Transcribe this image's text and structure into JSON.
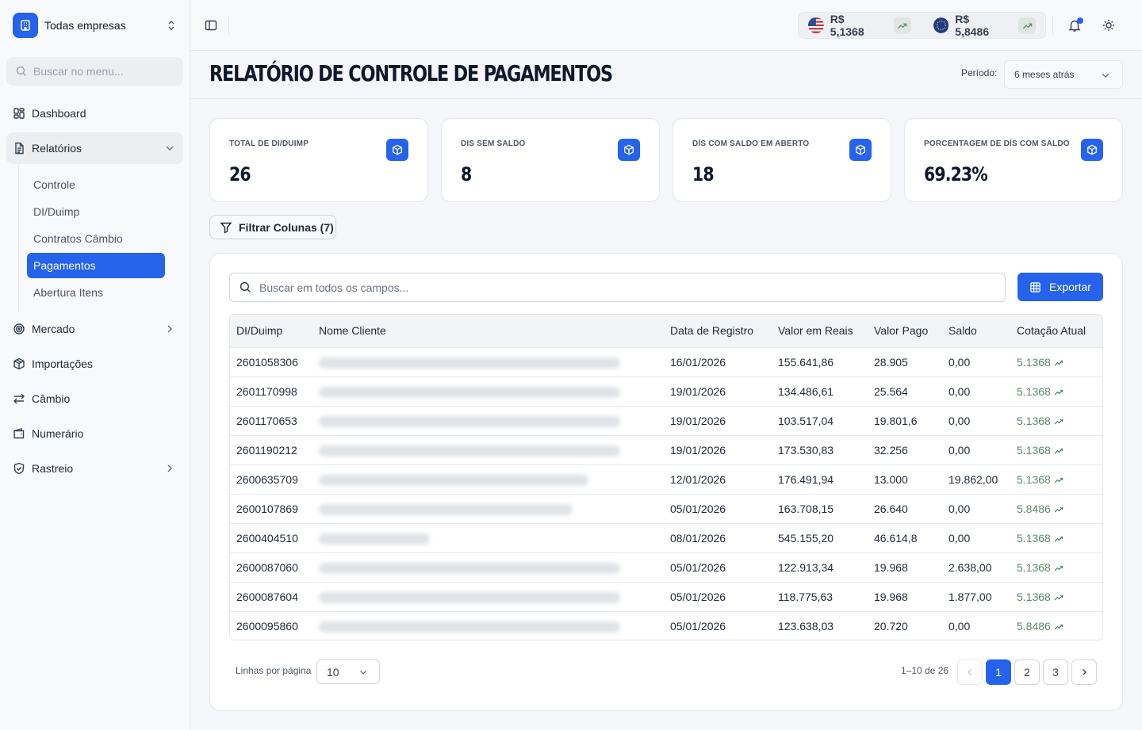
{
  "sidebar": {
    "company": "Todas empresas",
    "search_placeholder": "Buscar no menu...",
    "items": [
      {
        "label": "Dashboard",
        "icon": "layout-grid-icon"
      },
      {
        "label": "Relatórios",
        "icon": "file-text-icon",
        "expanded": true,
        "children": [
          "Controle",
          "DI/Duimp",
          "Contratos Câmbio",
          "Pagamentos",
          "Abertura Itens"
        ],
        "active_child": "Pagamentos"
      },
      {
        "label": "Mercado",
        "icon": "target-icon"
      },
      {
        "label": "Importações",
        "icon": "package-icon"
      },
      {
        "label": "Câmbio",
        "icon": "arrows-swap-icon"
      },
      {
        "label": "Numerário",
        "icon": "wallet-icon"
      },
      {
        "label": "Rastreio",
        "icon": "shield-icon"
      }
    ]
  },
  "topbar": {
    "rates": [
      {
        "currency": "USD",
        "value": "R$ 5,1368",
        "icon": "us-flag-icon"
      },
      {
        "currency": "EUR",
        "value": "R$ 5,8486",
        "icon": "eu-flag-icon"
      }
    ]
  },
  "page": {
    "title": "RELATÓRIO DE CONTROLE DE PAGAMENTOS",
    "period_label": "Período:",
    "period_value": "6 meses atrás"
  },
  "stats": [
    {
      "label": "TOTAL DE DI/DUIMP",
      "value": "26"
    },
    {
      "label": "DIS SEM SALDO",
      "value": "8"
    },
    {
      "label": "DÍS COM SALDO EM ABERTO",
      "value": "18"
    },
    {
      "label": "PORCENTAGEM DE DÍS COM SALDO",
      "value": "69.23%"
    }
  ],
  "filter_button": "Filtrar Colunas (7)",
  "table": {
    "search_placeholder": "Buscar em todos os campos...",
    "export_label": "Exportar",
    "columns": [
      "DI/Duimp",
      "Nome Cliente",
      "Data de Registro",
      "Valor em Reais",
      "Valor Pago",
      "Saldo",
      "Cotação Atual"
    ],
    "rows": [
      {
        "di": "2601058306",
        "date": "16/01/2026",
        "brl": "155.641,86",
        "paid": "28.905",
        "balance": "0,00",
        "rate": "5.1368"
      },
      {
        "di": "2601170998",
        "date": "19/01/2026",
        "brl": "134.486,61",
        "paid": "25.564",
        "balance": "0,00",
        "rate": "5.1368"
      },
      {
        "di": "2601170653",
        "date": "19/01/2026",
        "brl": "103.517,04",
        "paid": "19.801,6",
        "balance": "0,00",
        "rate": "5.1368"
      },
      {
        "di": "2601190212",
        "date": "19/01/2026",
        "brl": "173.530,83",
        "paid": "32.256",
        "balance": "0,00",
        "rate": "5.1368"
      },
      {
        "di": "2600635709",
        "date": "12/01/2026",
        "brl": "176.491,94",
        "paid": "13.000",
        "balance": "19.862,00",
        "rate": "5.1368"
      },
      {
        "di": "2600107869",
        "date": "05/01/2026",
        "brl": "163.708,15",
        "paid": "26.640",
        "balance": "0,00",
        "rate": "5.8486"
      },
      {
        "di": "2600404510",
        "date": "08/01/2026",
        "brl": "545.155,20",
        "paid": "46.614,8",
        "balance": "0,00",
        "rate": "5.1368"
      },
      {
        "di": "2600087060",
        "date": "05/01/2026",
        "brl": "122.913,34",
        "paid": "19.968",
        "balance": "2.638,00",
        "rate": "5.1368"
      },
      {
        "di": "2600087604",
        "date": "05/01/2026",
        "brl": "118.775,63",
        "paid": "19.968",
        "balance": "1.877,00",
        "rate": "5.1368"
      },
      {
        "di": "2600095860",
        "date": "05/01/2026",
        "brl": "123.638,03",
        "paid": "20.720",
        "balance": "0,00",
        "rate": "5.8486"
      }
    ]
  },
  "pagination": {
    "rows_label": "Linhas por página",
    "rows_value": "10",
    "range": "1–10 de 26",
    "pages": [
      "1",
      "2",
      "3"
    ],
    "current": "1"
  },
  "colors": {
    "accent": "#2563eb",
    "trend": "#5b8a6a"
  }
}
